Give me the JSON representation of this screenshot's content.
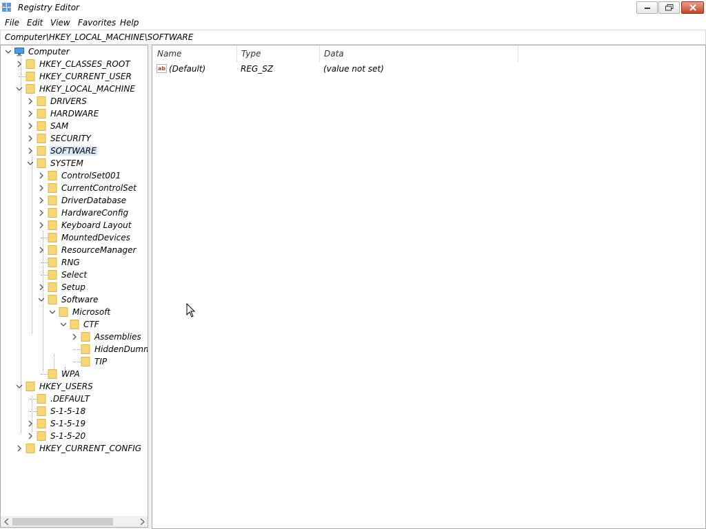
{
  "window": {
    "title": "Registry Editor"
  },
  "menu": [
    "File",
    "Edit",
    "View",
    "Favorites",
    "Help"
  ],
  "address": "Computer\\HKEY_LOCAL_MACHINE\\SOFTWARE",
  "tree": [
    {
      "label": "Computer",
      "depth": 0,
      "expander": "expanded",
      "icon": "computer-icon"
    },
    {
      "label": "HKEY_CLASSES_ROOT",
      "depth": 1,
      "expander": "collapsed"
    },
    {
      "label": "HKEY_CURRENT_USER",
      "depth": 1,
      "expander": "none"
    },
    {
      "label": "HKEY_LOCAL_MACHINE",
      "depth": 1,
      "expander": "expanded"
    },
    {
      "label": "DRIVERS",
      "depth": 2,
      "expander": "collapsed"
    },
    {
      "label": "HARDWARE",
      "depth": 2,
      "expander": "collapsed"
    },
    {
      "label": "SAM",
      "depth": 2,
      "expander": "collapsed"
    },
    {
      "label": "SECURITY",
      "depth": 2,
      "expander": "collapsed"
    },
    {
      "label": "SOFTWARE",
      "depth": 2,
      "expander": "collapsed",
      "selected": true
    },
    {
      "label": "SYSTEM",
      "depth": 2,
      "expander": "expanded"
    },
    {
      "label": "ControlSet001",
      "depth": 3,
      "expander": "collapsed"
    },
    {
      "label": "CurrentControlSet",
      "depth": 3,
      "expander": "collapsed"
    },
    {
      "label": "DriverDatabase",
      "depth": 3,
      "expander": "collapsed"
    },
    {
      "label": "HardwareConfig",
      "depth": 3,
      "expander": "collapsed"
    },
    {
      "label": "Keyboard Layout",
      "depth": 3,
      "expander": "collapsed"
    },
    {
      "label": "MountedDevices",
      "depth": 3,
      "expander": "none"
    },
    {
      "label": "ResourceManager",
      "depth": 3,
      "expander": "collapsed"
    },
    {
      "label": "RNG",
      "depth": 3,
      "expander": "none"
    },
    {
      "label": "Select",
      "depth": 3,
      "expander": "none"
    },
    {
      "label": "Setup",
      "depth": 3,
      "expander": "collapsed"
    },
    {
      "label": "Software",
      "depth": 3,
      "expander": "expanded"
    },
    {
      "label": "Microsoft",
      "depth": 4,
      "expander": "expanded"
    },
    {
      "label": "CTF",
      "depth": 5,
      "expander": "expanded"
    },
    {
      "label": "Assemblies",
      "depth": 6,
      "expander": "collapsed"
    },
    {
      "label": "HiddenDumm",
      "depth": 6,
      "expander": "none"
    },
    {
      "label": "TIP",
      "depth": 6,
      "expander": "none"
    },
    {
      "label": "WPA",
      "depth": 3,
      "expander": "none"
    },
    {
      "label": "HKEY_USERS",
      "depth": 1,
      "expander": "expanded"
    },
    {
      "label": ".DEFAULT",
      "depth": 2,
      "expander": "none"
    },
    {
      "label": "S-1-5-18",
      "depth": 2,
      "expander": "none"
    },
    {
      "label": "S-1-5-19",
      "depth": 2,
      "expander": "collapsed"
    },
    {
      "label": "S-1-5-20",
      "depth": 2,
      "expander": "collapsed"
    },
    {
      "label": "HKEY_CURRENT_CONFIG",
      "depth": 1,
      "expander": "collapsed"
    }
  ],
  "columns": {
    "name": "Name",
    "type": "Type",
    "data": "Data"
  },
  "values": [
    {
      "name": "(Default)",
      "type": "REG_SZ",
      "data": "(value not set)",
      "icon": "string-value-icon"
    }
  ],
  "colors": {
    "folder": "#f8d775",
    "folder_edge": "#dcb44a",
    "selection": "#d9e8f9",
    "close_button": "#c6442c"
  }
}
